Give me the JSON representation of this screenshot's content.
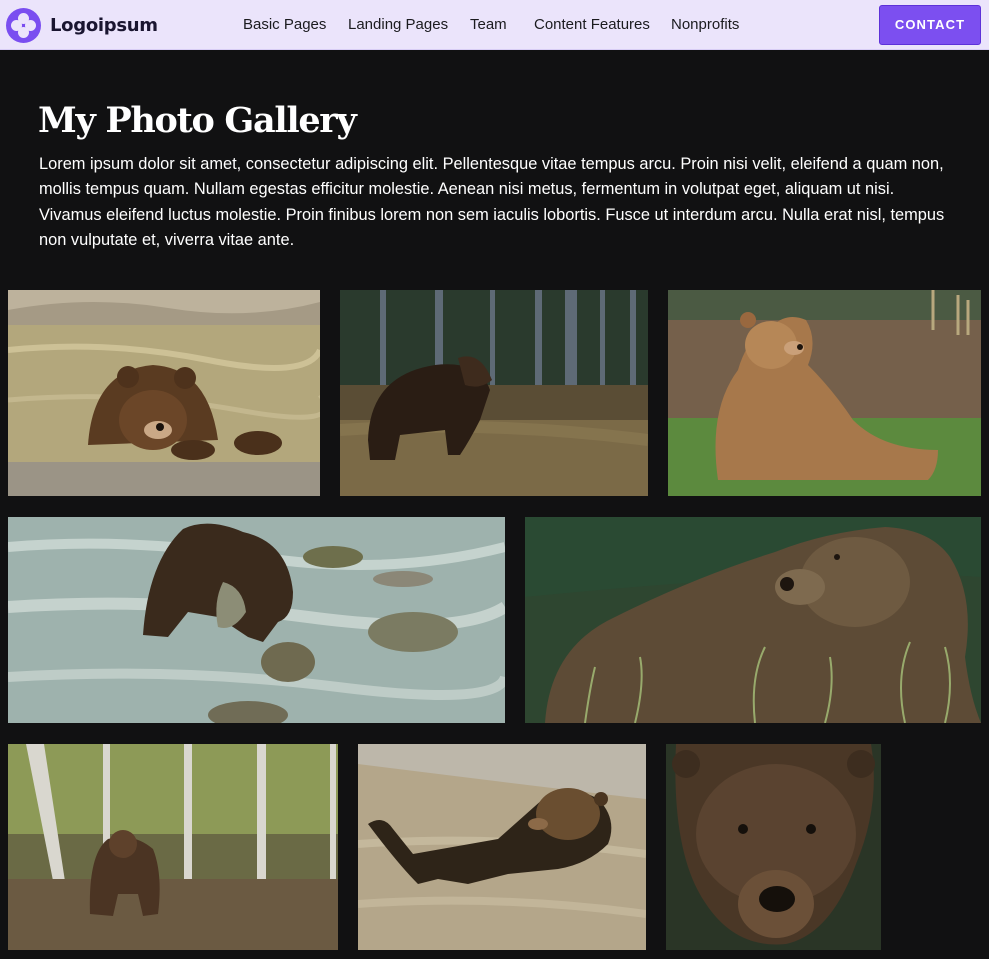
{
  "header": {
    "logo_text": "Logoipsum",
    "nav": [
      "Basic Pages",
      "Landing Pages",
      "Team",
      "Content Features",
      "Nonprofits"
    ],
    "contact_label": "CONTACT"
  },
  "main": {
    "title": "My Photo Gallery",
    "intro": "Lorem ipsum dolor sit amet, consectetur adipiscing elit. Pellentesque vitae tempus arcu. Proin nisi velit, eleifend a quam non, mollis tempus quam. Nullam egestas efficitur molestie. Aenean nisi metus, fermentum in volutpat eget, aliquam ut nisi. Vivamus eleifend luctus molestie. Proin finibus lorem non sem iaculis lobortis. Fusce ut interdum arcu. Nulla erat nisl, tempus non vulputate et, viverra vitae ante."
  },
  "gallery": {
    "photos": [
      {
        "subject": "bear-resting-in-pool"
      },
      {
        "subject": "bear-walking-in-forest"
      },
      {
        "subject": "bear-sitting-on-grass"
      },
      {
        "subject": "bear-catching-fish-in-river"
      },
      {
        "subject": "bear-close-up-in-grass"
      },
      {
        "subject": "bear-in-birch-forest"
      },
      {
        "subject": "bear-floating-in-water"
      },
      {
        "subject": "bear-face-portrait"
      }
    ]
  },
  "colors": {
    "header_bg": "#ebe4fb",
    "accent": "#7c4ff0",
    "page_bg": "#111112",
    "text": "#ffffff"
  }
}
